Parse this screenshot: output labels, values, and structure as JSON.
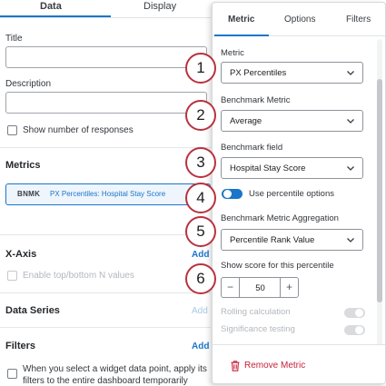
{
  "left": {
    "tabs": [
      {
        "label": "Data",
        "active": true
      },
      {
        "label": "Display",
        "active": false
      }
    ],
    "title_label": "Title",
    "description_label": "Description",
    "show_responses_label": "Show number of responses",
    "metrics": {
      "title": "Metrics",
      "chip_tag": "BNMK",
      "chip_text": "PX Percentiles: Hospital Stay Score"
    },
    "x_axis": {
      "title": "X-Axis",
      "add_label": "Add",
      "topn_label": "Enable top/bottom N values"
    },
    "data_series": {
      "title": "Data Series",
      "add_label": "Add"
    },
    "filters": {
      "title": "Filters",
      "add_label": "Add",
      "checkbox_label": "When you select a widget data point, apply its filters to the entire dashboard temporarily"
    }
  },
  "panel": {
    "tabs": [
      {
        "label": "Metric",
        "active": true
      },
      {
        "label": "Options",
        "active": false
      },
      {
        "label": "Filters",
        "active": false
      }
    ],
    "metric": {
      "label": "Metric",
      "value": "PX Percentiles"
    },
    "benchmark_metric": {
      "label": "Benchmark Metric",
      "value": "Average"
    },
    "benchmark_field": {
      "label": "Benchmark field",
      "value": "Hospital Stay Score"
    },
    "percentile_options": {
      "label": "Use percentile options",
      "on": true
    },
    "aggregation": {
      "label": "Benchmark Metric Aggregation",
      "value": "Percentile Rank Value"
    },
    "percentile": {
      "label": "Show score for this percentile",
      "value": "50",
      "minus": "−",
      "plus": "+"
    },
    "rolling": {
      "label": "Rolling calculation",
      "on": false
    },
    "significance": {
      "label": "Significance testing",
      "on": false
    },
    "remove_label": "Remove Metric"
  },
  "callouts": [
    "1",
    "2",
    "3",
    "4",
    "5",
    "6"
  ],
  "colors": {
    "accent": "#1b76c9",
    "danger": "#c8213a",
    "callout_ring": "#b8323f"
  }
}
